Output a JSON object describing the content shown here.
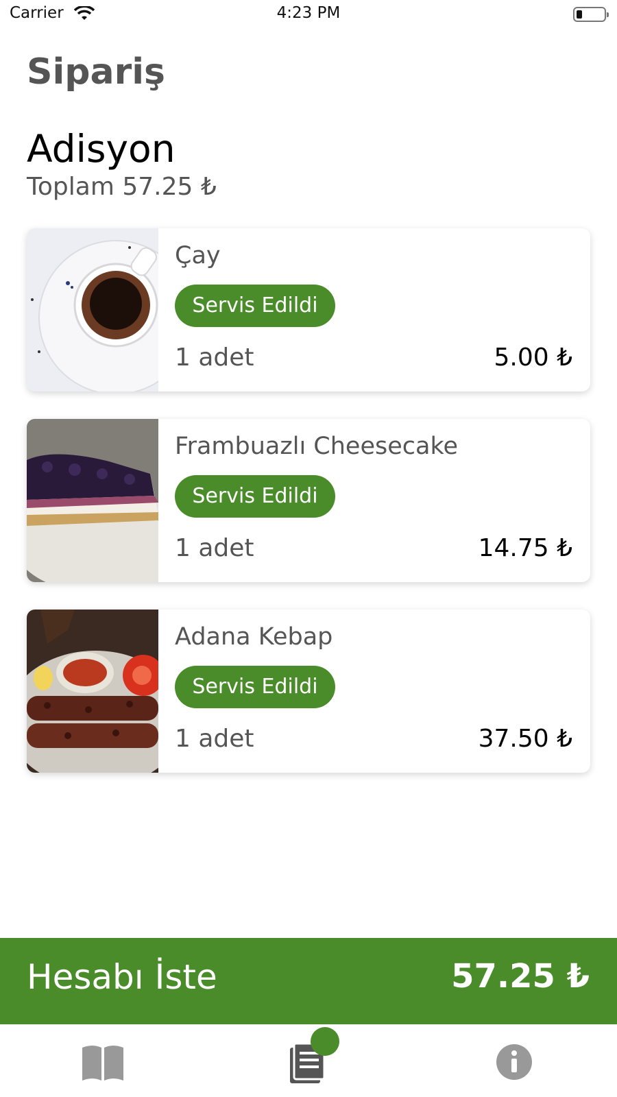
{
  "status_bar": {
    "carrier": "Carrier",
    "time": "4:23 PM"
  },
  "header": {
    "title": "Sipariş"
  },
  "bill": {
    "title": "Adisyon",
    "total_line": "Toplam 57.25 ₺"
  },
  "items": [
    {
      "name": "Çay",
      "status": "Servis Edildi",
      "quantity": "1 adet",
      "price": "5.00 ₺"
    },
    {
      "name": "Frambuazlı Cheesecake",
      "status": "Servis Edildi",
      "quantity": "1 adet",
      "price": "14.75 ₺"
    },
    {
      "name": "Adana Kebap",
      "status": "Servis Edildi",
      "quantity": "1 adet",
      "price": "37.50 ₺"
    }
  ],
  "checkout": {
    "label": "Hesabı İste",
    "total": "57.25 ₺"
  },
  "tabs": [
    {
      "icon": "book-icon"
    },
    {
      "icon": "order-list-icon",
      "badge": true
    },
    {
      "icon": "info-icon"
    }
  ],
  "colors": {
    "accent": "#4a8c2a",
    "text_muted": "#555555"
  }
}
